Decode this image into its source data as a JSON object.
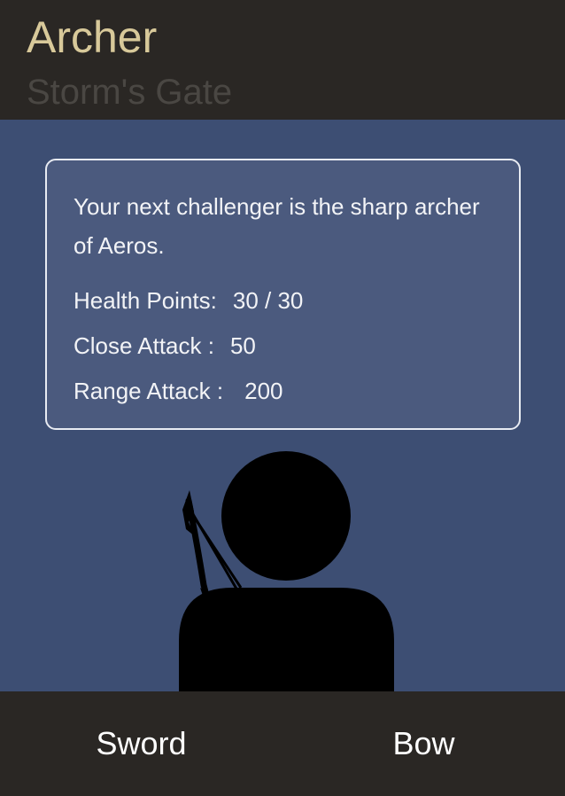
{
  "header": {
    "title": "Archer",
    "subtitle": "Storm's Gate"
  },
  "enemy": {
    "intro": "Your next challenger is the sharp archer of Aeros.",
    "stats": [
      {
        "label": "Health Points:",
        "value": "30 / 30"
      },
      {
        "label": "Close Attack :",
        "value": "50"
      },
      {
        "label": "Range Attack :",
        "value": "200"
      }
    ],
    "figure_icon": "archer-silhouette-icon"
  },
  "actions": {
    "sword_label": "Sword",
    "bow_label": "Bow"
  },
  "colors": {
    "header_bg": "#2a2724",
    "title": "#d8c99a",
    "subtitle": "#4a4743",
    "scene_bg": "#3d4e73",
    "card_bg": "#4b5a7e",
    "card_border": "#e8ebf2",
    "footer_bg": "#2a2724",
    "button_text": "#ffffff"
  }
}
